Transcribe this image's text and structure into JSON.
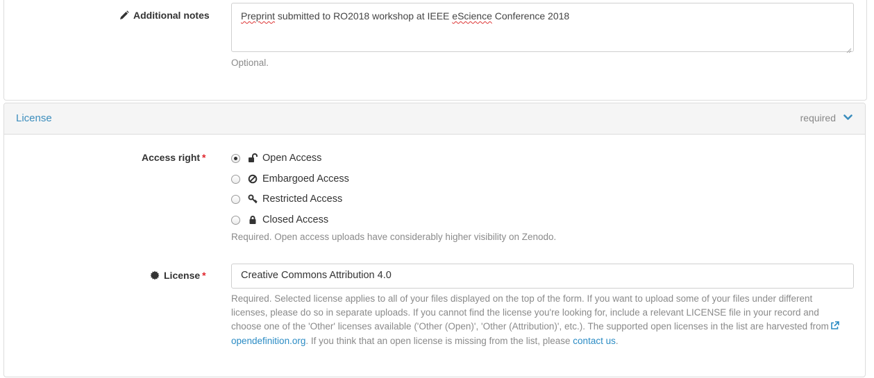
{
  "notes": {
    "label": "Additional notes",
    "value_parts": [
      "Preprint",
      " submitted to RO2018 workshop at IEEE ",
      "eScience",
      " Conference 2018"
    ],
    "help": "Optional."
  },
  "license_panel": {
    "title": "License",
    "required": "required",
    "access_right": {
      "label": "Access right",
      "required_mark": "*",
      "options": [
        {
          "label": "Open Access",
          "icon": "unlock-icon",
          "selected": true
        },
        {
          "label": "Embargoed Access",
          "icon": "ban-icon",
          "selected": false
        },
        {
          "label": "Restricted Access",
          "icon": "key-icon",
          "selected": false
        },
        {
          "label": "Closed Access",
          "icon": "lock-icon",
          "selected": false
        }
      ],
      "help": "Required. Open access uploads have considerably higher visibility on Zenodo."
    },
    "license": {
      "label": "License",
      "required_mark": "*",
      "icon": "certificate-icon",
      "value": "Creative Commons Attribution 4.0",
      "help_line1": "Required. Selected license applies to all of your files displayed on the top of the form. If you want to upload some of your files under different",
      "help_line2": "licenses, please do so in separate uploads. If you cannot find the license you're looking for, include a relevant LICENSE file in your record and",
      "help_line3": "choose one of the 'Other' licenses available ('Other (Open)', 'Other (Attribution)', etc.). The supported open licenses in the list are harvested from",
      "help_link1": "opendefinition.org",
      "help_mid": ". If you think that an open license is missing from the list, please ",
      "help_link2": "contact us",
      "help_end": "."
    }
  },
  "colors": {
    "accent": "#3b8dbd",
    "required": "#e0242b",
    "help_text": "#8a8a8a"
  }
}
